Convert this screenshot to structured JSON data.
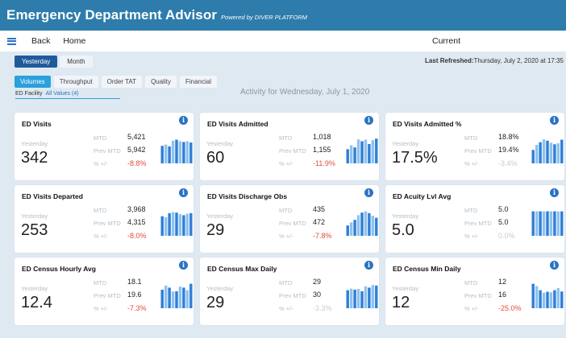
{
  "app": {
    "title": "Emergency Department Advisor",
    "powered": "Powered by DIVER PLATFORM"
  },
  "nav": {
    "back": "Back",
    "home": "Home",
    "current": "Current"
  },
  "period_tabs": [
    "Yesterday",
    "Month"
  ],
  "refreshed": {
    "label": "Last Refreshed:",
    "value": "Thursday, July 2, 2020  at 17:35"
  },
  "category_tabs": [
    "Volumes",
    "Throughput",
    "Order TAT",
    "Quality",
    "Financial"
  ],
  "facility": {
    "label": "ED Facility",
    "value": "All Values (4)"
  },
  "activity_title": "Activity for Wednesday, July 1, 2020",
  "labels": {
    "yesterday": "Yesterday",
    "mtd": "MTD",
    "prev_mtd": "Prev MTD",
    "pct": "% +/-"
  },
  "colors": {
    "brand": "#2e7cab",
    "accent": "#2aa0dc",
    "bar_dark": "#2f7fd6",
    "bar_light": "#8ec2ef",
    "negative": "#e14b3b"
  },
  "icons": {
    "info": "info-icon",
    "menu": "hamburger-menu-icon"
  },
  "cards": [
    {
      "title": "ED Visits",
      "yesterday": "342",
      "mtd": "5,421",
      "prev_mtd": "5,942",
      "pct": "-8.8%",
      "pct_style": "neg",
      "spark": [
        0.68,
        0.73,
        0.66,
        0.88,
        0.92,
        0.86,
        0.83,
        0.86,
        0.81
      ]
    },
    {
      "title": "ED Visits Admitted",
      "yesterday": "60",
      "mtd": "1,018",
      "prev_mtd": "1,155",
      "pct": "-11.9%",
      "pct_style": "neg",
      "spark": [
        0.55,
        0.7,
        0.62,
        0.93,
        0.86,
        0.92,
        0.75,
        0.9,
        0.96
      ]
    },
    {
      "title": "ED Visits Admitted %",
      "yesterday": "17.5%",
      "mtd": "18.8%",
      "prev_mtd": "19.4%",
      "pct": "-3.4%",
      "pct_style": "pale",
      "spark": [
        0.52,
        0.72,
        0.82,
        0.93,
        0.88,
        0.8,
        0.74,
        0.78,
        0.92
      ]
    },
    {
      "title": "ED Visits Departed",
      "yesterday": "253",
      "mtd": "3,968",
      "prev_mtd": "4,315",
      "pct": "-8.0%",
      "pct_style": "neg",
      "spark": [
        0.76,
        0.72,
        0.88,
        0.92,
        0.9,
        0.84,
        0.8,
        0.86,
        0.88
      ]
    },
    {
      "title": "ED Visits Discharge Obs",
      "yesterday": "29",
      "mtd": "435",
      "prev_mtd": "472",
      "pct": "-7.8%",
      "pct_style": "neg",
      "spark": [
        0.4,
        0.52,
        0.62,
        0.8,
        0.9,
        0.95,
        0.88,
        0.78,
        0.7
      ]
    },
    {
      "title": "ED Acuity Lvl Avg",
      "yesterday": "5.0",
      "mtd": "5.0",
      "prev_mtd": "5.0",
      "pct": "0.0%",
      "pct_style": "pale",
      "spark": [
        0.95,
        0.95,
        0.95,
        0.95,
        0.95,
        0.95,
        0.95,
        0.95,
        0.95
      ]
    },
    {
      "title": "ED Census Hourly Avg",
      "yesterday": "12.4",
      "mtd": "18.1",
      "prev_mtd": "19.6",
      "pct": "-7.3%",
      "pct_style": "neg",
      "spark": [
        0.72,
        0.88,
        0.8,
        0.65,
        0.66,
        0.84,
        0.8,
        0.7,
        0.95
      ]
    },
    {
      "title": "ED Census Max Daily",
      "yesterday": "29",
      "mtd": "29",
      "prev_mtd": "30",
      "pct": "-3.3%",
      "pct_style": "pale",
      "spark": [
        0.7,
        0.76,
        0.72,
        0.75,
        0.66,
        0.85,
        0.8,
        0.9,
        0.88
      ]
    },
    {
      "title": "ED Census Min Daily",
      "yesterday": "12",
      "mtd": "12",
      "prev_mtd": "16",
      "pct": "-25.0%",
      "pct_style": "neg",
      "spark": [
        0.95,
        0.86,
        0.7,
        0.6,
        0.64,
        0.62,
        0.7,
        0.78,
        0.65
      ]
    }
  ]
}
